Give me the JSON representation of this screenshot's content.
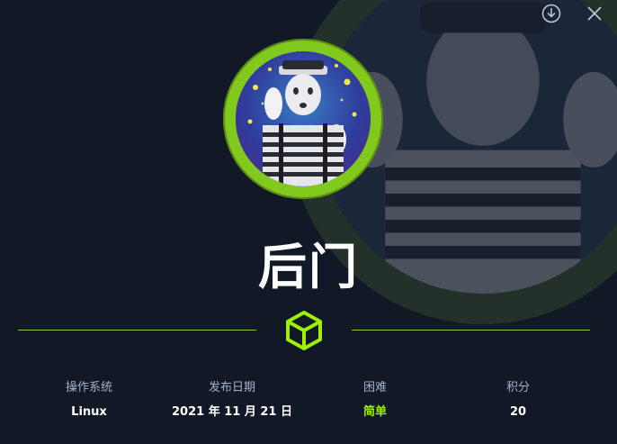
{
  "header": {
    "download_icon": "download-circle-icon",
    "close_icon": "close-icon"
  },
  "machine": {
    "name": "后门",
    "avatar": "mime-avatar",
    "difficulty_icon": "cube-icon"
  },
  "stats": [
    {
      "label": "操作系统",
      "value": "Linux"
    },
    {
      "label": "发布日期",
      "value": "2021 年 11 月 21 日"
    },
    {
      "label": "困难",
      "value": "简单"
    },
    {
      "label": "积分",
      "value": "20"
    }
  ],
  "colors": {
    "background": "#111927",
    "accent": "#9fef00",
    "ring": "#82c91e",
    "label": "#a4b1cd"
  }
}
